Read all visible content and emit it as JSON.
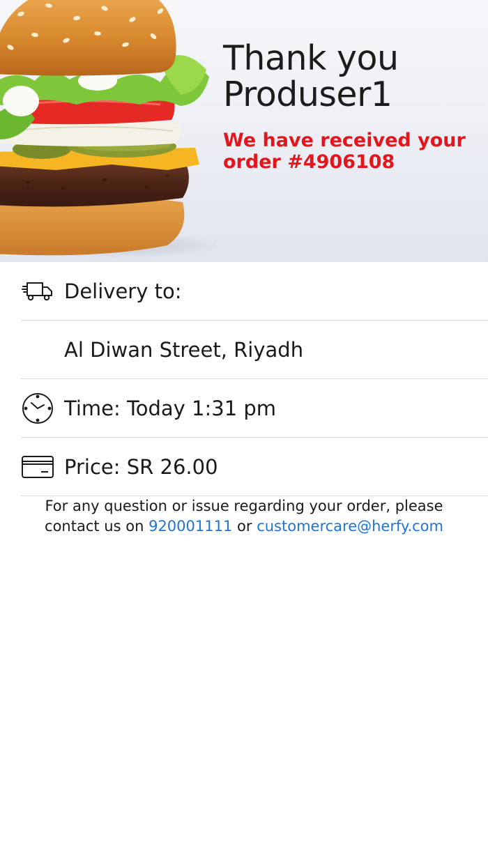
{
  "hero": {
    "thank_you_line1": "Thank you",
    "thank_you_line2": "Produser1",
    "received_line1": "We have received your",
    "received_line2": "order #4906108"
  },
  "details": {
    "delivery_label": "Delivery to:",
    "delivery_icon": "delivery-truck-icon",
    "address": "Al Diwan Street, Riyadh",
    "time": "Time: Today 1:31 pm",
    "time_icon": "clock-icon",
    "price": "Price: SR 26.00",
    "price_icon": "credit-card-icon"
  },
  "footer": {
    "line1": "For any question or issue regarding your order, please",
    "line2_prefix": "contact us on",
    "phone": "920001111",
    "or": "or",
    "email": "customercare@herfy.com"
  },
  "colors": {
    "accent_red": "#e3161d",
    "link_blue": "#1f74d8",
    "divider": "#dcdcdc"
  }
}
